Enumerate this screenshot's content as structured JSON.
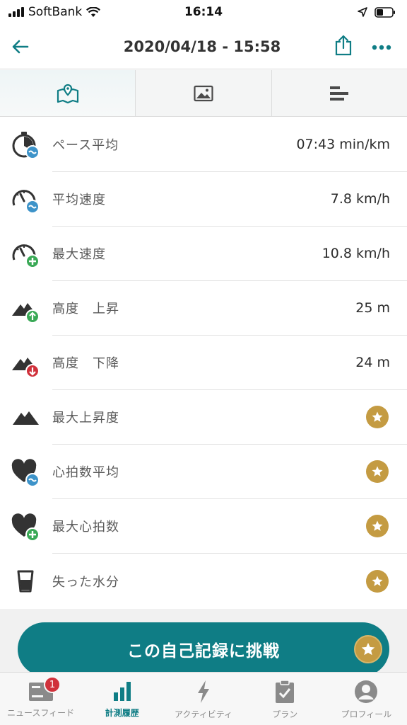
{
  "status_bar": {
    "carrier": "SoftBank",
    "time": "16:14"
  },
  "header": {
    "title": "2020/04/18 - 15:58"
  },
  "tabs": [
    {
      "icon": "map-icon",
      "active": true
    },
    {
      "icon": "image-icon",
      "active": false
    },
    {
      "icon": "bar-chart-icon",
      "active": false
    }
  ],
  "stats": [
    {
      "label": "ペース平均",
      "value": "07:43 min/km",
      "icon": "pace-average-icon"
    },
    {
      "label": "平均速度",
      "value": "7.8 km/h",
      "icon": "speed-average-icon"
    },
    {
      "label": "最大速度",
      "value": "10.8 km/h",
      "icon": "speed-max-icon"
    },
    {
      "label": "高度　上昇",
      "value": "25 m",
      "icon": "altitude-up-icon"
    },
    {
      "label": "高度　下降",
      "value": "24 m",
      "icon": "altitude-down-icon"
    },
    {
      "label": "最大上昇度",
      "value": "",
      "icon": "mountain-icon"
    },
    {
      "label": "心拍数平均",
      "value": "",
      "icon": "heart-average-icon"
    },
    {
      "label": "最大心拍数",
      "value": "",
      "icon": "heart-max-icon"
    },
    {
      "label": "失った水分",
      "value": "",
      "icon": "glass-icon"
    }
  ],
  "cta": {
    "label": "この自己記録に挑戦"
  },
  "tabbar": {
    "items": [
      {
        "label": "ニュースフィード",
        "badge": "1"
      },
      {
        "label": "計測履歴"
      },
      {
        "label": "アクティビティ"
      },
      {
        "label": "プラン"
      },
      {
        "label": "プロフィール"
      }
    ]
  },
  "colors": {
    "accent": "#0f7d85",
    "gold": "#c49b42",
    "badge_red": "#d0313b",
    "blue_badge": "#3d93c9",
    "green_badge": "#3aa956"
  }
}
